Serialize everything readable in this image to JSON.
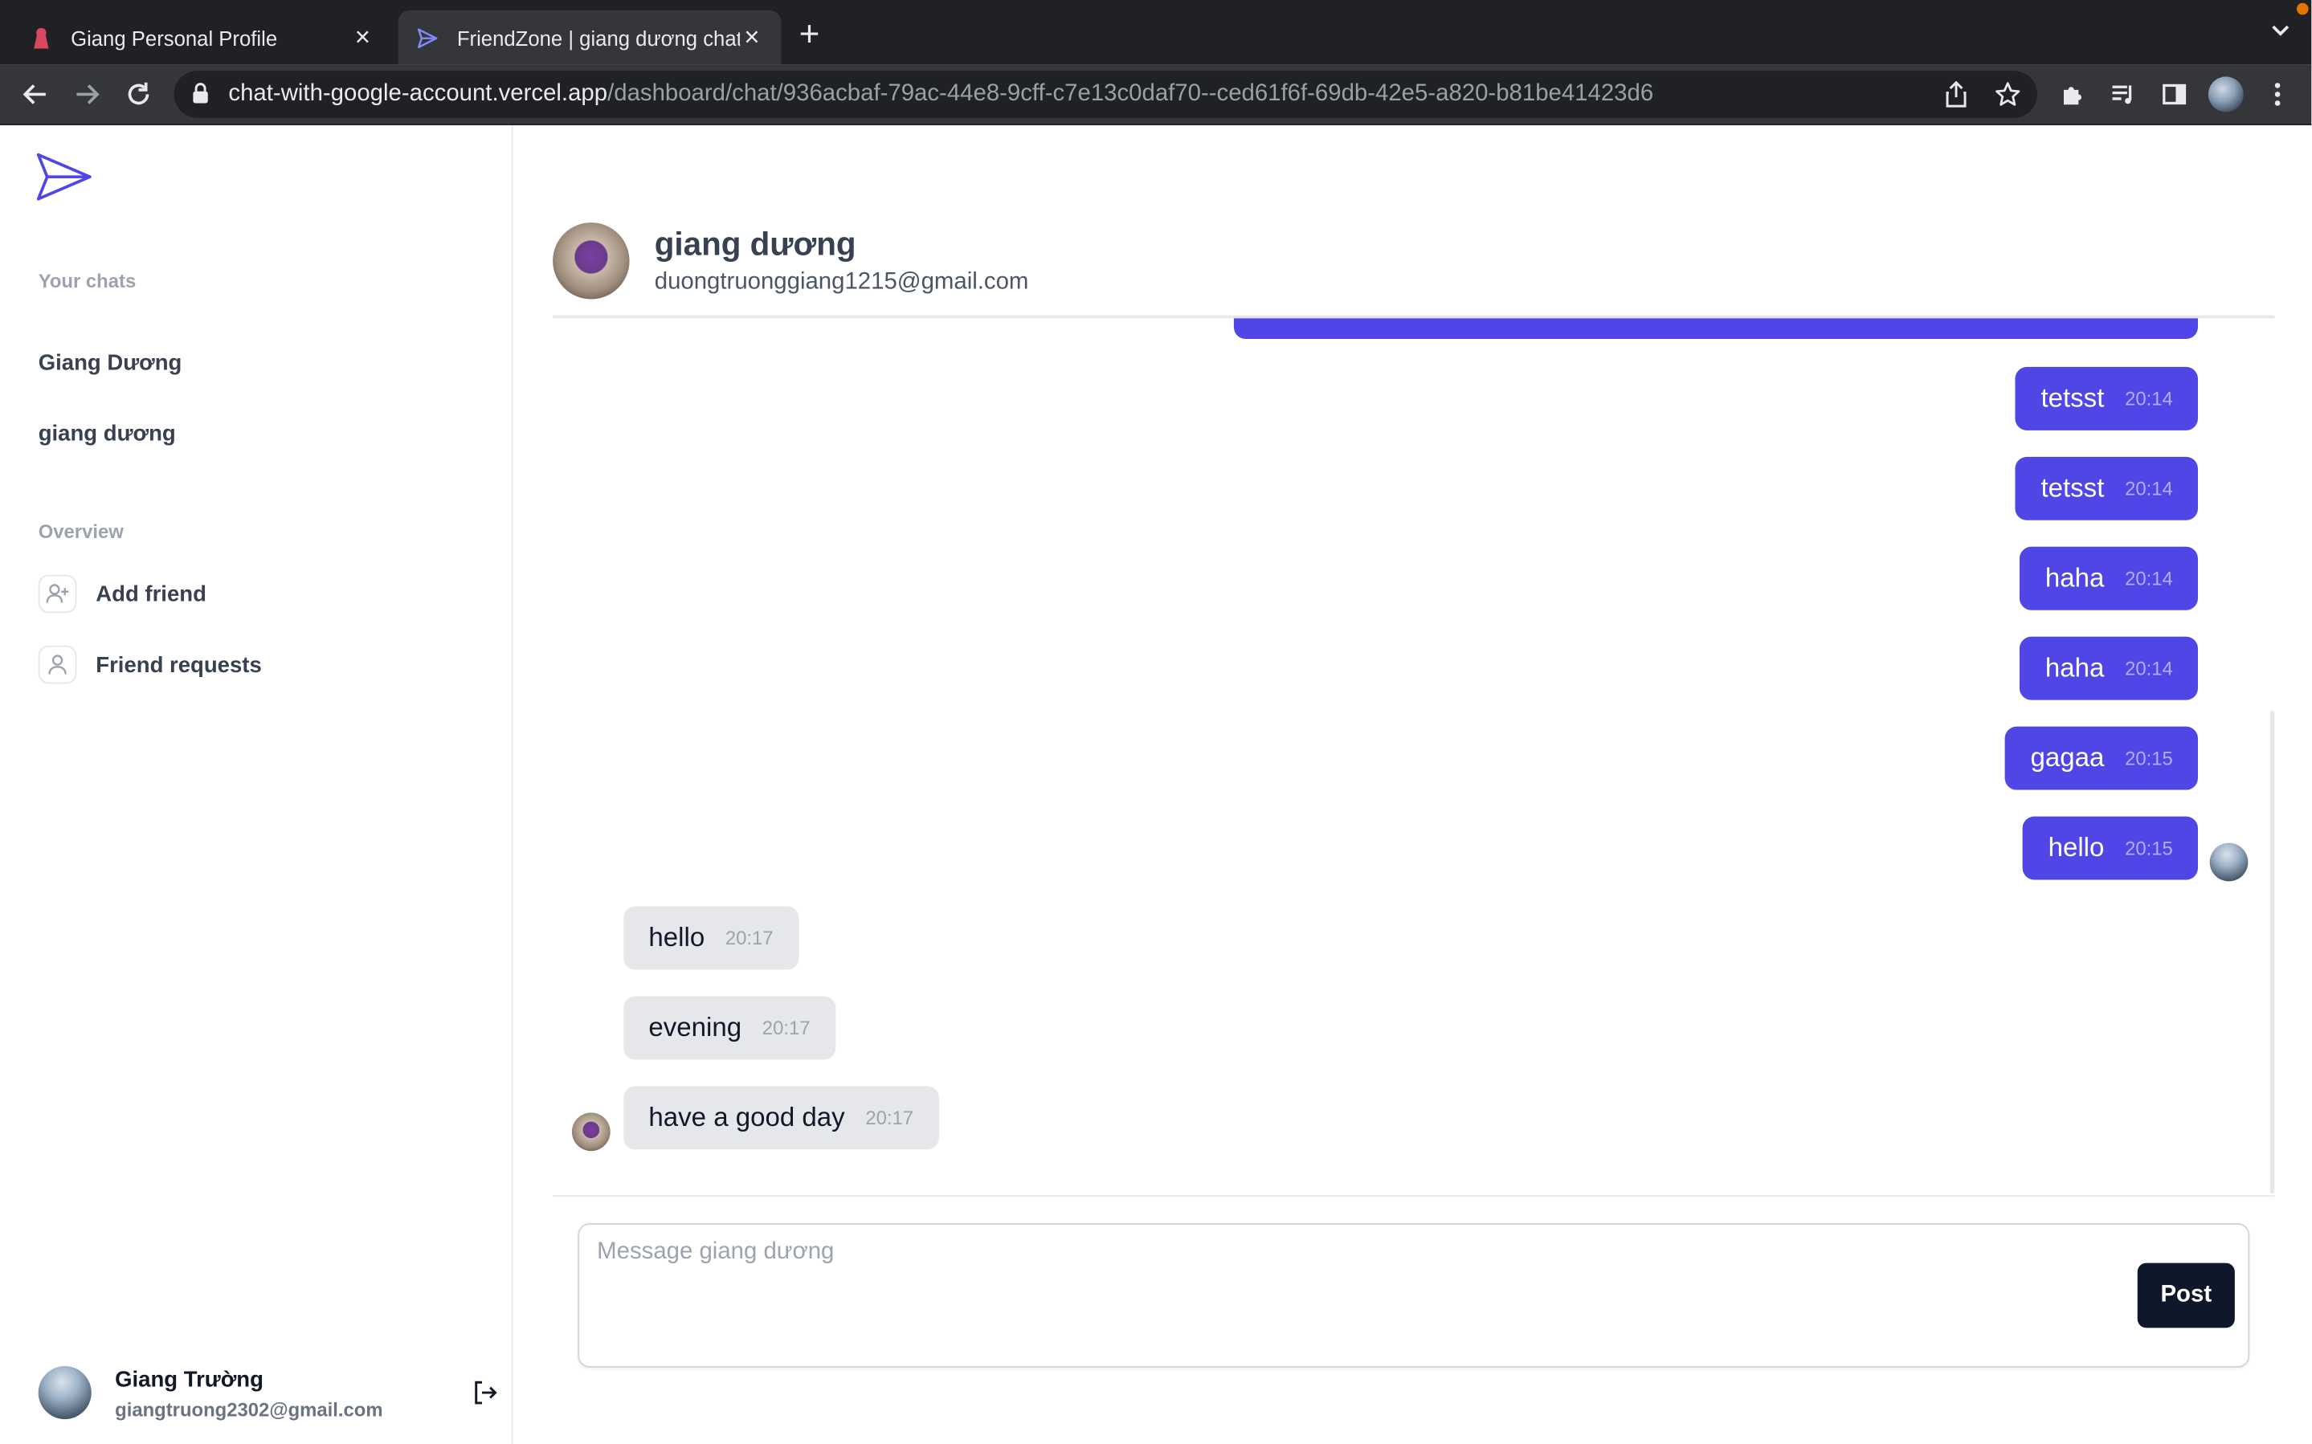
{
  "browser": {
    "tabs": [
      {
        "title": "Giang Personal Profile",
        "active": false
      },
      {
        "title": "FriendZone | giang dương chat",
        "active": true
      }
    ],
    "url_host": "chat-with-google-account.vercel.app",
    "url_path": "/dashboard/chat/936acbaf-79ac-44e8-9cff-c7e13c0daf70--ced61f6f-69db-42e5-a820-b81be41423d6"
  },
  "sidebar": {
    "your_chats_label": "Your chats",
    "chats": [
      "Giang Dương",
      "giang dương"
    ],
    "overview_label": "Overview",
    "overview_items": [
      {
        "label": "Add friend",
        "icon": "user-plus-icon"
      },
      {
        "label": "Friend requests",
        "icon": "user-icon"
      }
    ],
    "user": {
      "name": "Giang Trường",
      "email": "giangtruong2302@gmail.com"
    }
  },
  "chat": {
    "partner_name": "giang dương",
    "partner_email": "duongtruonggiang1215@gmail.com",
    "messages": [
      {
        "text": "tetsst",
        "time": "20:14",
        "from": "me"
      },
      {
        "text": "tetsst",
        "time": "20:14",
        "from": "me"
      },
      {
        "text": "haha",
        "time": "20:14",
        "from": "me"
      },
      {
        "text": "haha",
        "time": "20:14",
        "from": "me"
      },
      {
        "text": "gagaa",
        "time": "20:15",
        "from": "me"
      },
      {
        "text": "hello",
        "time": "20:15",
        "from": "me"
      },
      {
        "text": "hello",
        "time": "20:17",
        "from": "them"
      },
      {
        "text": "evening",
        "time": "20:17",
        "from": "them"
      },
      {
        "text": "have a good day",
        "time": "20:17",
        "from": "them"
      }
    ],
    "composer_placeholder": "Message giang dương",
    "post_label": "Post"
  },
  "colors": {
    "accent": "#4f46e5",
    "incoming_bubble": "#e5e7eb",
    "post_button": "#0f172a"
  }
}
